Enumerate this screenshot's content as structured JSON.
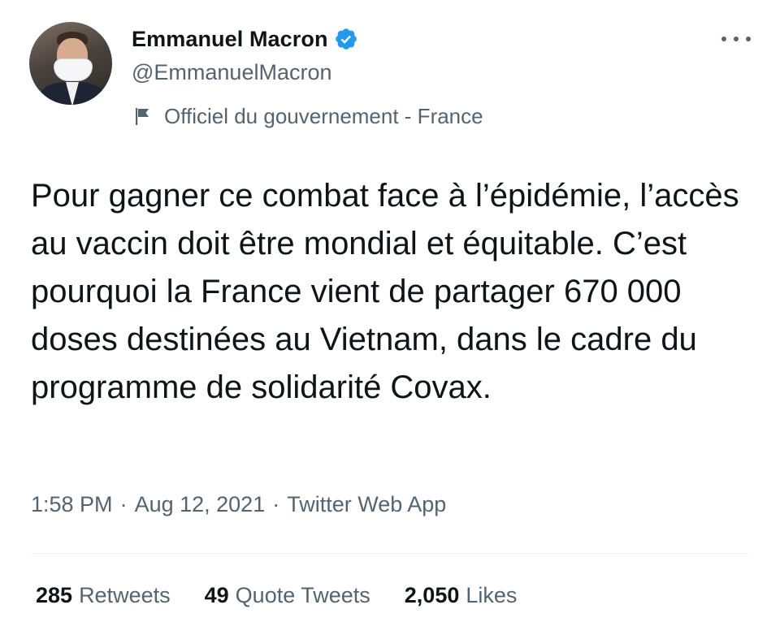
{
  "user": {
    "display_name": "Emmanuel Macron",
    "handle": "@EmmanuelMacron",
    "label": "Officiel du gouvernement - France",
    "verified": true
  },
  "icons": {
    "verified": "verified-badge-icon",
    "label": "flag-icon",
    "more": "more-options-icon"
  },
  "tweet": {
    "text": "Pour gagner ce combat face à l’épidémie, l’accès au vaccin doit être mondial et équitable. C’est pourquoi la France vient de partager 670 000 doses destinées au Vietnam, dans le cadre du programme de solidarité Covax."
  },
  "meta": {
    "time": "1:58 PM",
    "separator": "·",
    "date": "Aug 12, 2021",
    "source": "Twitter Web App"
  },
  "stats": [
    {
      "count": "285",
      "label": "Retweets"
    },
    {
      "count": "49",
      "label": "Quote Tweets"
    },
    {
      "count": "2,050",
      "label": "Likes"
    }
  ],
  "colors": {
    "verified_blue": "#1d9bf0",
    "text_primary": "#0f1419",
    "text_secondary": "#536471"
  }
}
